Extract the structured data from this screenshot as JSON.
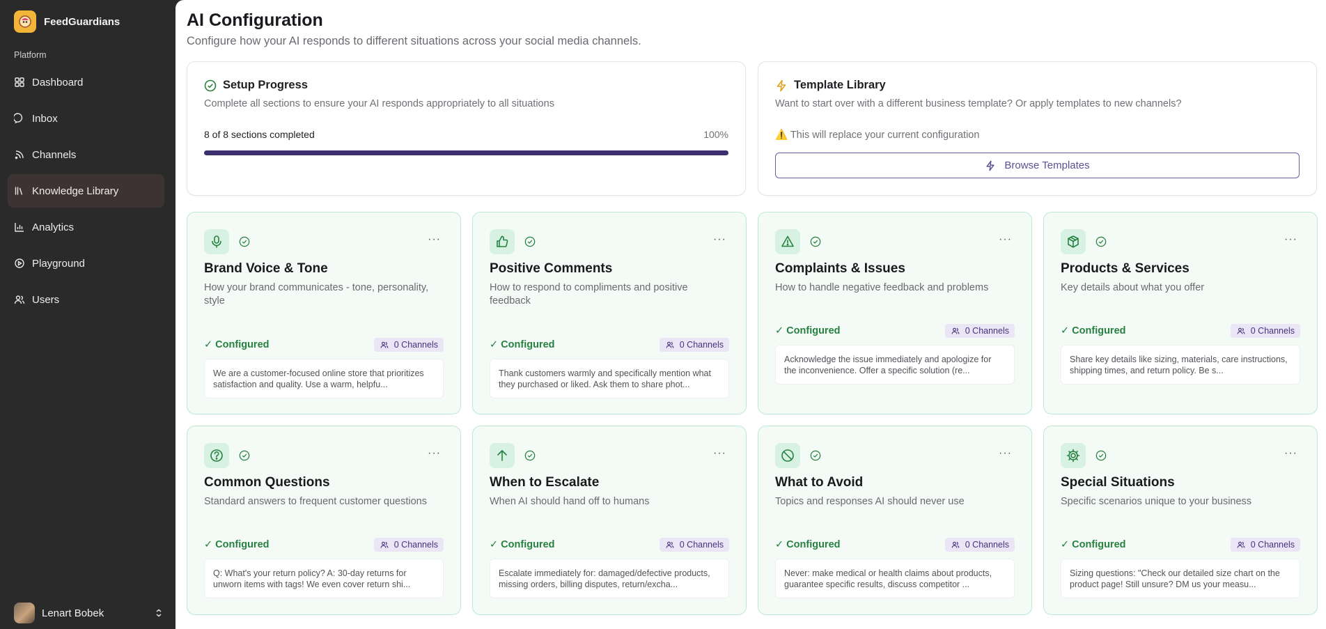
{
  "app": {
    "name": "FeedGuardians"
  },
  "sidebar": {
    "section_label": "Platform",
    "items": [
      {
        "label": "Dashboard",
        "icon": "dashboard-icon"
      },
      {
        "label": "Inbox",
        "icon": "message-icon"
      },
      {
        "label": "Channels",
        "icon": "rss-icon"
      },
      {
        "label": "Knowledge Library",
        "icon": "library-icon",
        "active": true
      },
      {
        "label": "Analytics",
        "icon": "chart-icon"
      },
      {
        "label": "Playground",
        "icon": "play-icon"
      },
      {
        "label": "Users",
        "icon": "users-icon"
      }
    ],
    "user": {
      "name": "Lenart Bobek"
    }
  },
  "header": {
    "title": "AI Configuration",
    "subtitle": "Configure how your AI responds to different situations across your social media channels."
  },
  "setup": {
    "title": "Setup Progress",
    "description": "Complete all sections to ensure your AI responds appropriately to all situations",
    "progress_text": "8 of 8 sections completed",
    "percent_label": "100%",
    "progress_fraction": 1.0
  },
  "templates": {
    "title": "Template Library",
    "description": "Want to start over with a different business template? Or apply templates to new channels?",
    "warning": "⚠️ This will replace your current configuration",
    "button_label": "Browse Templates"
  },
  "colors": {
    "accent": "#3c2f6e",
    "success": "#27803f",
    "card_bg": "#f4fbf7"
  },
  "cards": [
    {
      "title": "Brand Voice & Tone",
      "icon": "microphone-icon",
      "description": "How your brand communicates - tone, personality, style",
      "status": "✓ Configured",
      "channels": "0 Channels",
      "preview": "We are a customer-focused online store that prioritizes satisfaction and quality. Use a warm, helpfu..."
    },
    {
      "title": "Positive Comments",
      "icon": "thumbs-up-icon",
      "description": "How to respond to compliments and positive feedback",
      "status": "✓ Configured",
      "channels": "0 Channels",
      "preview": "Thank customers warmly and specifically mention what they purchased or liked. Ask them to share phot..."
    },
    {
      "title": "Complaints & Issues",
      "icon": "warning-icon",
      "description": "How to handle negative feedback and problems",
      "status": "✓ Configured",
      "channels": "0 Channels",
      "preview": "Acknowledge the issue immediately and apologize for the inconvenience. Offer a specific solution (re..."
    },
    {
      "title": "Products & Services",
      "icon": "package-icon",
      "description": "Key details about what you offer",
      "status": "✓ Configured",
      "channels": "0 Channels",
      "preview": "Share key details like sizing, materials, care instructions, shipping times, and return policy. Be s..."
    },
    {
      "title": "Common Questions",
      "icon": "question-icon",
      "description": "Standard answers to frequent customer questions",
      "status": "✓ Configured",
      "channels": "0 Channels",
      "preview": "Q: What's your return policy? A: 30-day returns for unworn items with tags! We even cover return shi..."
    },
    {
      "title": "When to Escalate",
      "icon": "arrow-up-icon",
      "description": "When AI should hand off to humans",
      "status": "✓ Configured",
      "channels": "0 Channels",
      "preview": "Escalate immediately for: damaged/defective products, missing orders, billing disputes, return/excha..."
    },
    {
      "title": "What to Avoid",
      "icon": "ban-icon",
      "description": "Topics and responses AI should never use",
      "status": "✓ Configured",
      "channels": "0 Channels",
      "preview": "Never: make medical or health claims about products, guarantee specific results, discuss competitor ..."
    },
    {
      "title": "Special Situations",
      "icon": "gear-icon",
      "description": "Specific scenarios unique to your business",
      "status": "✓ Configured",
      "channels": "0 Channels",
      "preview": "Sizing questions: \"Check our detailed size chart on the product page! Still unsure? DM us your measu..."
    }
  ]
}
